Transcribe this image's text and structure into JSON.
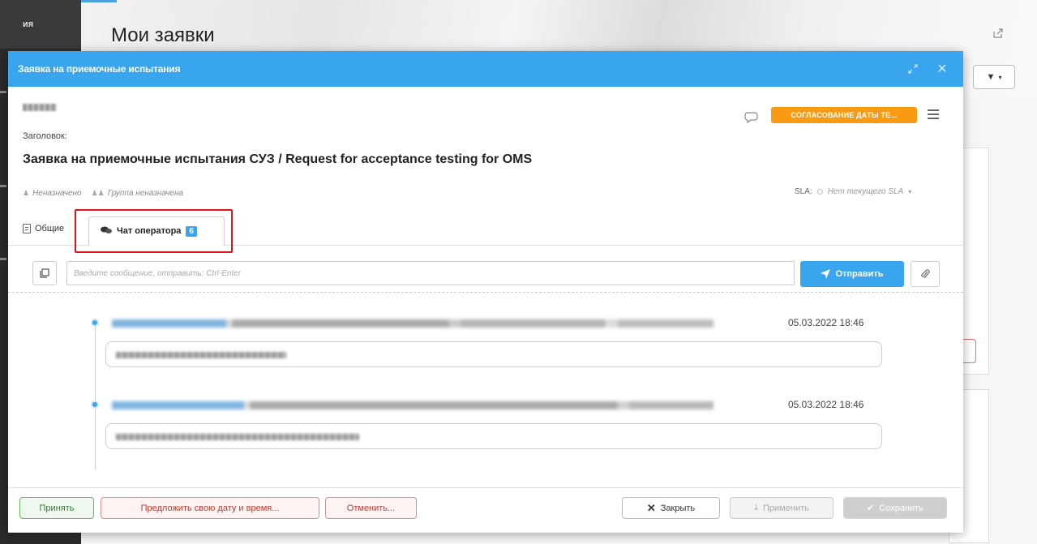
{
  "background": {
    "nav_label": "ия",
    "page_title": "Мои заявки"
  },
  "modal": {
    "title": "Заявка на приемочные испытания",
    "heading_label": "Заголовок:",
    "ticket_title": "Заявка на приемочные испытания СУЗ / Request for acceptance testing for OMS",
    "assignee": "Неназначено",
    "group": "Группа неназначена",
    "status_badge": "СОГЛАСОВАНИЕ ДАТЫ ТЕ...",
    "sla_label": "SLA:",
    "sla_value": "Нет текущего SLA"
  },
  "tabs": {
    "general": "Общие",
    "chat": "Чат оператора",
    "chat_count": "6"
  },
  "composer": {
    "placeholder": "Введите сообщение, отправить: Ctrl-Enter",
    "send_label": "Отправить"
  },
  "messages": [
    {
      "time": "05.03.2022 18:46"
    },
    {
      "time": "05.03.2022 18:46"
    }
  ],
  "footer": {
    "accept": "Принять",
    "propose": "Предложить свою дату и время...",
    "cancel": "Отменить...",
    "close": "Закрыть",
    "apply": "Применить",
    "save": "Сохранить"
  },
  "colors": {
    "header": "#3aa5ef",
    "status": "#f89b12",
    "highlight": "#e5121b"
  }
}
